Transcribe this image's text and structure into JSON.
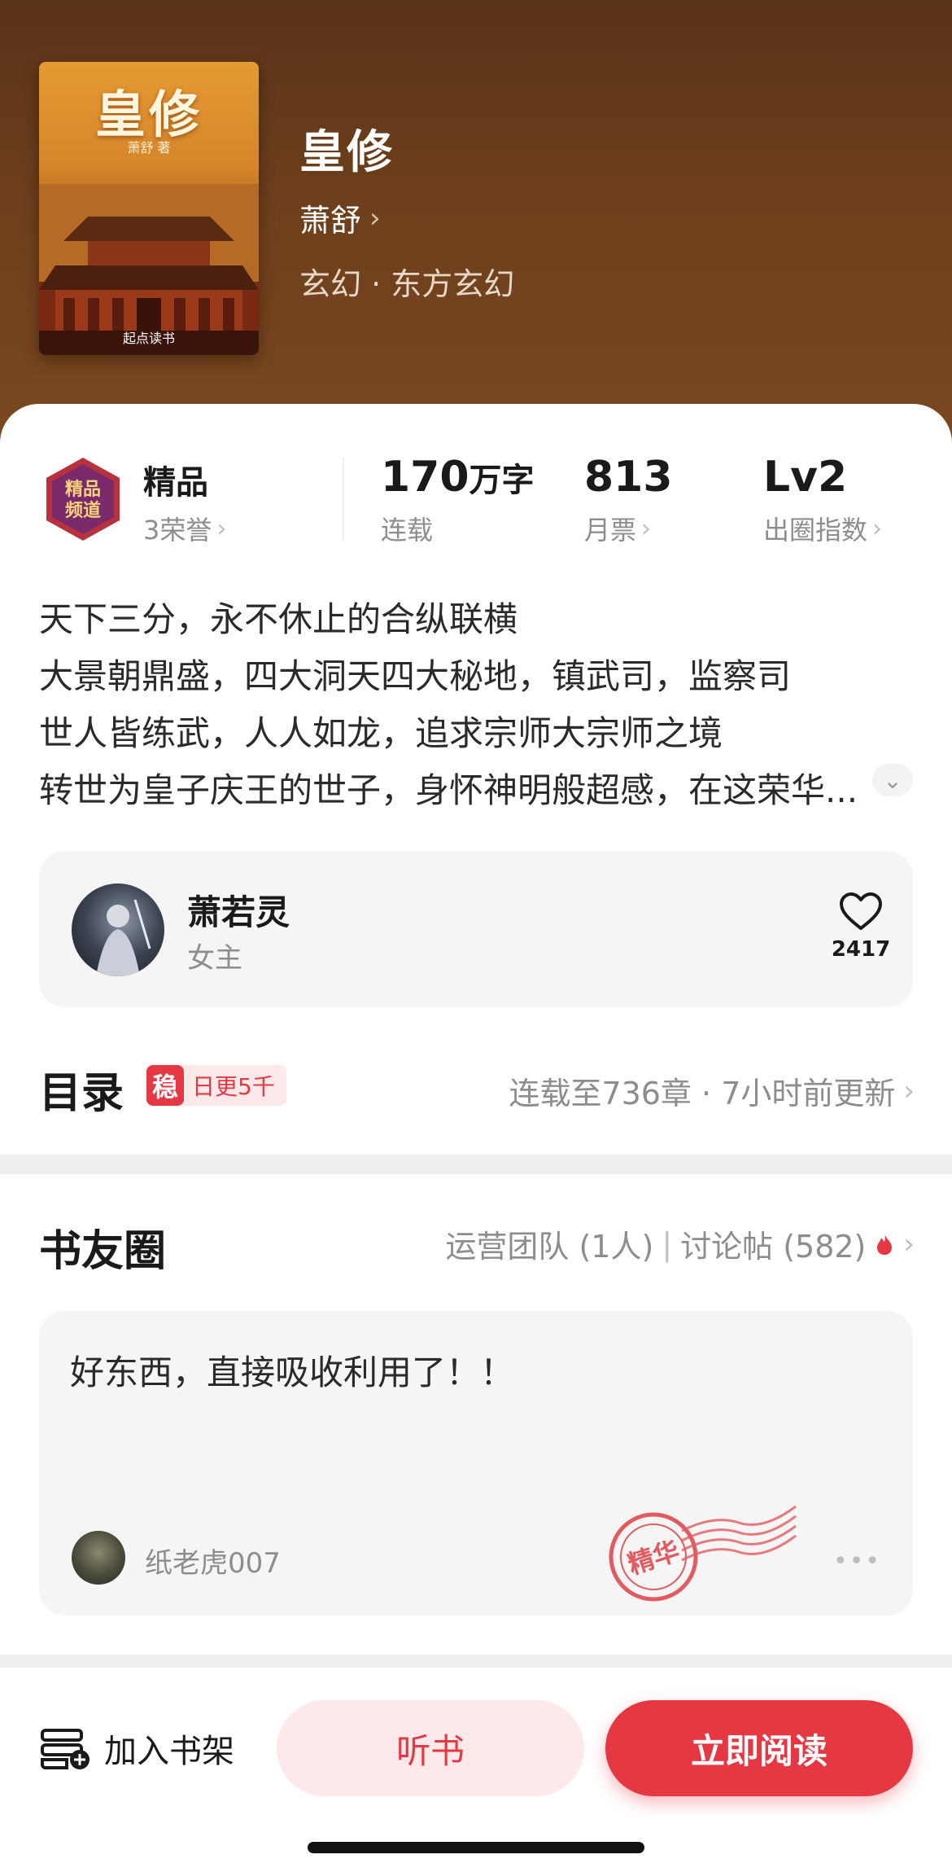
{
  "book": {
    "cover_title": "皇修",
    "cover_author": "萧舒 著",
    "cover_brand": "起点读书",
    "title": "皇修",
    "author": "萧舒",
    "genre": "玄幻 · 东方玄幻"
  },
  "stats": {
    "quality_label": "精品",
    "honor_count": "3荣誉",
    "word_count_number": "170",
    "word_count_unit": "万字",
    "status": "连载",
    "monthly_votes": "813",
    "monthly_votes_label": "月票",
    "circle_level": "Lv2",
    "circle_level_label": "出圈指数"
  },
  "synopsis": [
    "天下三分，永不休止的合纵联横",
    "大景朝鼎盛，四大洞天四大秘地，镇武司，监察司",
    "世人皆练武，人人如龙，追求宗师大宗师之境",
    "转世为皇子庆王的世子，身怀神明般超感，在这荣华..."
  ],
  "character": {
    "name": "萧若灵",
    "role": "女主",
    "likes": "2417"
  },
  "toc": {
    "title": "目录",
    "tag_icon": "稳",
    "tag_text": "日更5千",
    "status": "连载至736章 · 7小时前更新"
  },
  "circle": {
    "title": "书友圈",
    "team": "运营团队 (1人)",
    "separator": "|",
    "posts": "讨论帖 (582)"
  },
  "post": {
    "text": "好东西，直接吸收利用了！！",
    "user": "纸老虎007",
    "stamp": "精华",
    "more": "•••"
  },
  "bottom": {
    "shelf_label": "加入书架",
    "listen_label": "听书",
    "read_label": "立即阅读"
  },
  "colors": {
    "accent": "#e63843",
    "header_bg": "#6e3f1c"
  }
}
